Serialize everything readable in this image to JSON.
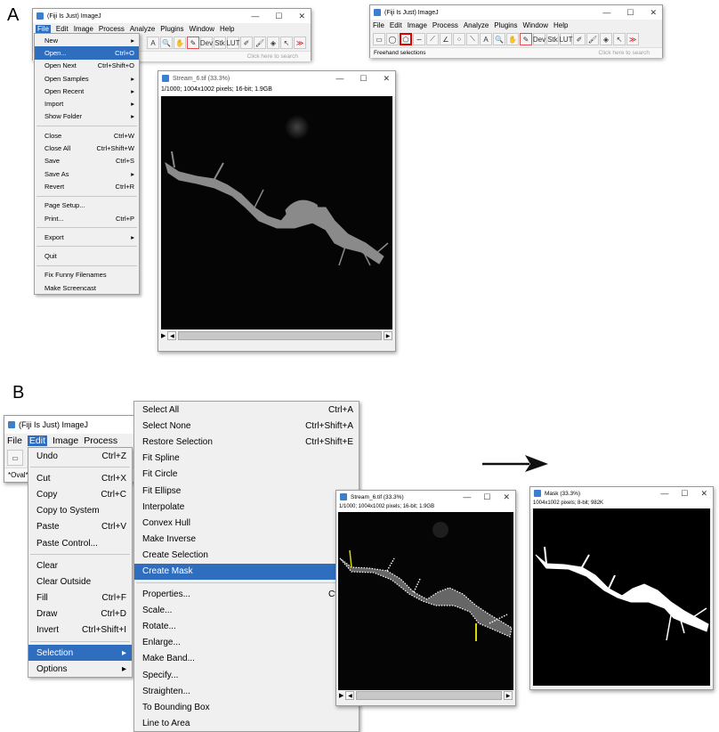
{
  "panels": {
    "a": "A",
    "b": "B"
  },
  "app_title": "(Fiji Is Just) ImageJ",
  "window_buttons": {
    "minimize": "—",
    "maximize": "☐",
    "close": "✕"
  },
  "menubar": [
    "File",
    "Edit",
    "Image",
    "Process",
    "Analyze",
    "Plugins",
    "Window",
    "Help"
  ],
  "toolbar_tools": [
    "rectangle",
    "oval",
    "polygon",
    "freehand",
    "line",
    "angle",
    "point",
    "wand",
    "text",
    "magnifier",
    "hand",
    "color-picker",
    "Dev",
    "Stk",
    "LUT",
    "pencil",
    "brush",
    "flood-fill",
    "arrow",
    "more"
  ],
  "toolbar_glyphs": [
    "▭",
    "◯",
    "⬠",
    "∽",
    "⟋",
    "∠",
    "⁘",
    "⟍",
    "A",
    "🔍",
    "✋",
    "✎",
    "Dev",
    "Stk",
    "LUT",
    "✐",
    "🖌",
    "◈",
    "↖",
    "≫"
  ],
  "search_placeholder": "Click here to search",
  "status_freehand": "Freehand selections",
  "status_oval": "*Oval*",
  "file_menu": [
    {
      "label": "New",
      "shortcut": "",
      "submenu": true
    },
    {
      "label": "Open...",
      "shortcut": "Ctrl+O",
      "highlight": true
    },
    {
      "label": "Open Next",
      "shortcut": "Ctrl+Shift+O"
    },
    {
      "label": "Open Samples",
      "shortcut": "",
      "submenu": true
    },
    {
      "label": "Open Recent",
      "shortcut": "",
      "submenu": true
    },
    {
      "label": "Import",
      "shortcut": "",
      "submenu": true
    },
    {
      "label": "Show Folder",
      "shortcut": "",
      "submenu": true
    },
    {
      "sep": true
    },
    {
      "label": "Close",
      "shortcut": "Ctrl+W"
    },
    {
      "label": "Close All",
      "shortcut": "Ctrl+Shift+W"
    },
    {
      "label": "Save",
      "shortcut": "Ctrl+S"
    },
    {
      "label": "Save As",
      "shortcut": "",
      "submenu": true
    },
    {
      "label": "Revert",
      "shortcut": "Ctrl+R"
    },
    {
      "sep": true
    },
    {
      "label": "Page Setup...",
      "shortcut": ""
    },
    {
      "label": "Print...",
      "shortcut": "Ctrl+P"
    },
    {
      "sep": true
    },
    {
      "label": "Export",
      "shortcut": "",
      "submenu": true
    },
    {
      "sep": true
    },
    {
      "label": "Quit",
      "shortcut": ""
    },
    {
      "sep": true
    },
    {
      "label": "Fix Funny Filenames",
      "shortcut": ""
    },
    {
      "label": "Make Screencast",
      "shortcut": ""
    }
  ],
  "edit_menu": [
    {
      "label": "Undo",
      "shortcut": "Ctrl+Z"
    },
    {
      "sep": true
    },
    {
      "label": "Cut",
      "shortcut": "Ctrl+X"
    },
    {
      "label": "Copy",
      "shortcut": "Ctrl+C"
    },
    {
      "label": "Copy to System",
      "shortcut": ""
    },
    {
      "label": "Paste",
      "shortcut": "Ctrl+V"
    },
    {
      "label": "Paste Control...",
      "shortcut": ""
    },
    {
      "sep": true
    },
    {
      "label": "Clear",
      "shortcut": ""
    },
    {
      "label": "Clear Outside",
      "shortcut": ""
    },
    {
      "label": "Fill",
      "shortcut": "Ctrl+F"
    },
    {
      "label": "Draw",
      "shortcut": "Ctrl+D"
    },
    {
      "label": "Invert",
      "shortcut": "Ctrl+Shift+I"
    },
    {
      "sep": true
    },
    {
      "label": "Selection",
      "shortcut": "",
      "submenu": true,
      "highlight": true
    },
    {
      "label": "Options",
      "shortcut": "",
      "submenu": true
    }
  ],
  "selection_menu": [
    {
      "label": "Select All",
      "shortcut": "Ctrl+A"
    },
    {
      "label": "Select None",
      "shortcut": "Ctrl+Shift+A"
    },
    {
      "label": "Restore Selection",
      "shortcut": "Ctrl+Shift+E"
    },
    {
      "label": "Fit Spline",
      "shortcut": ""
    },
    {
      "label": "Fit Circle",
      "shortcut": ""
    },
    {
      "label": "Fit Ellipse",
      "shortcut": ""
    },
    {
      "label": "Interpolate",
      "shortcut": ""
    },
    {
      "label": "Convex Hull",
      "shortcut": ""
    },
    {
      "label": "Make Inverse",
      "shortcut": ""
    },
    {
      "label": "Create Selection",
      "shortcut": ""
    },
    {
      "label": "Create Mask",
      "shortcut": "",
      "highlight": true
    },
    {
      "sep": true
    },
    {
      "label": "Properties...",
      "shortcut": "Ctrl+Y"
    },
    {
      "label": "Scale...",
      "shortcut": ""
    },
    {
      "label": "Rotate...",
      "shortcut": ""
    },
    {
      "label": "Enlarge...",
      "shortcut": ""
    },
    {
      "label": "Make Band...",
      "shortcut": ""
    },
    {
      "label": "Specify...",
      "shortcut": ""
    },
    {
      "label": "Straighten...",
      "shortcut": ""
    },
    {
      "label": "To Bounding Box",
      "shortcut": ""
    },
    {
      "label": "Line to Area",
      "shortcut": ""
    }
  ],
  "stream_window": {
    "title": "Stream_6.tif (33.3%)",
    "info": "1/1000; 1004x1002 pixels; 16-bit; 1.9GB"
  },
  "mask_window": {
    "title": "Mask (33.3%)",
    "info": "1004x1002 pixels; 8-bit; 982K"
  },
  "colors": {
    "highlight": "#2f6ebf",
    "selected_tool_border": "#e00000",
    "roi_yellow": "#d8d800"
  }
}
